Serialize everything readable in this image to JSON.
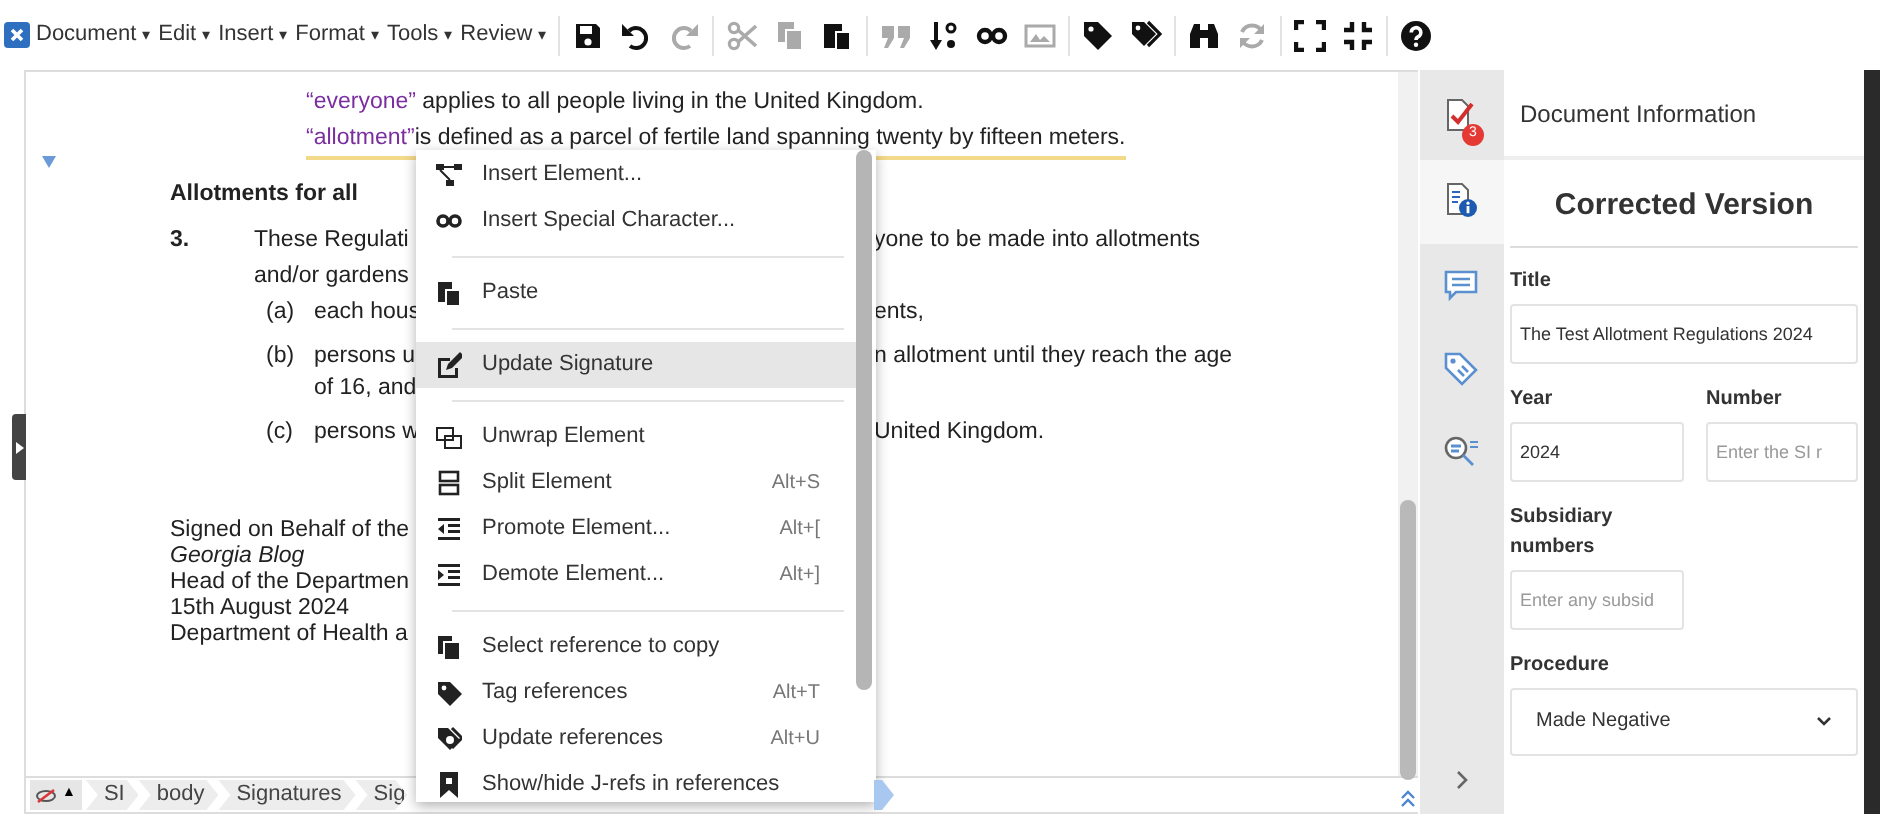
{
  "menubar": [
    {
      "label": "Document",
      "caret": "▾"
    },
    {
      "label": "Edit",
      "caret": "▾"
    },
    {
      "label": "Insert",
      "caret": "▾"
    },
    {
      "label": "Format",
      "caret": "▾"
    },
    {
      "label": "Tools",
      "caret": "▾"
    },
    {
      "label": "Review",
      "caret": "▾"
    }
  ],
  "toolbar": {
    "groups": [
      [
        {
          "disabled": false
        },
        {
          "disabled": false
        },
        {
          "disabled": true
        }
      ],
      [
        {
          "disabled": true
        },
        {
          "disabled": true
        },
        {
          "disabled": false
        }
      ],
      [
        {
          "disabled": true
        },
        {
          "disabled": false
        },
        {
          "disabled": false
        },
        {
          "disabled": true
        }
      ],
      [
        {
          "disabled": false
        },
        {
          "disabled": false
        }
      ],
      [
        {
          "disabled": false
        },
        {
          "disabled": true
        }
      ],
      [
        {
          "disabled": false
        },
        {
          "disabled": false
        }
      ],
      [
        {
          "disabled": false
        }
      ]
    ]
  },
  "document": {
    "definitions": [
      {
        "term": "“everyone”",
        "text": " applies to all people living in the United Kingdom.",
        "underlined": false
      },
      {
        "term": "“allotment”",
        "text": "is defined as a parcel of fertile land spanning twenty by fifteen meters.",
        "underlined": true
      }
    ],
    "heading": "Allotments for all",
    "paragraph": {
      "number": "3.",
      "lines": [
        {
          "left": "These Regulati",
          "right": "yone to be made into allotments"
        },
        {
          "left": "and/or gardens"
        }
      ]
    },
    "items": [
      {
        "label": "(a)",
        "lines": [
          {
            "left": "each hous",
            "right": "ents,"
          }
        ]
      },
      {
        "label": "(b)",
        "lines": [
          {
            "left": "persons u",
            "right": "n allotment until they reach the age"
          },
          {
            "left": "of 16, and"
          }
        ]
      },
      {
        "label": "(c)",
        "lines": [
          {
            "left": "persons w",
            "right": "United Kingdom."
          }
        ]
      }
    ],
    "signature": [
      {
        "text": "Signed on Behalf of the",
        "italic": false
      },
      {
        "text": "Georgia Blog",
        "italic": true
      },
      {
        "text": "Head of the Departmen",
        "italic": false
      },
      {
        "text": "15th August 2024",
        "italic": false
      },
      {
        "text": "Department of Health a",
        "italic": false
      }
    ]
  },
  "breadcrumb": {
    "toggle": "▲",
    "items": [
      {
        "label": "SI",
        "selected": false
      },
      {
        "label": "body",
        "selected": false
      },
      {
        "label": "Signatures",
        "selected": false
      },
      {
        "label": "Sig",
        "selected": false
      },
      {
        "selected": true
      }
    ]
  },
  "context_menu": [
    {
      "kind": "item",
      "label": "Insert Element...",
      "selected": false
    },
    {
      "kind": "item",
      "label": "Insert Special Character...",
      "selected": false
    },
    {
      "kind": "separator"
    },
    {
      "kind": "item",
      "label": "Paste",
      "selected": false
    },
    {
      "kind": "separator"
    },
    {
      "kind": "item",
      "label": "Update Signature",
      "selected": true
    },
    {
      "kind": "separator"
    },
    {
      "kind": "item",
      "label": "Unwrap Element",
      "selected": false
    },
    {
      "kind": "item",
      "label": "Split Element",
      "shortcut": "Alt+S",
      "selected": false
    },
    {
      "kind": "item",
      "label": "Promote Element...",
      "shortcut": "Alt+[",
      "selected": false
    },
    {
      "kind": "item",
      "label": "Demote Element...",
      "shortcut": "Alt+]",
      "selected": false
    },
    {
      "kind": "separator"
    },
    {
      "kind": "item",
      "label": "Select reference to copy",
      "selected": false
    },
    {
      "kind": "item",
      "label": "Tag references",
      "shortcut": "Alt+T",
      "selected": false
    },
    {
      "kind": "item",
      "label": "Update references",
      "shortcut": "Alt+U",
      "selected": false
    },
    {
      "kind": "item",
      "label": "Show/hide J-refs in references",
      "selected": false
    }
  ],
  "side_tabs": [
    {
      "selected": false,
      "badge": "3"
    },
    {
      "selected": true
    },
    {
      "selected": false
    },
    {
      "selected": false
    },
    {
      "selected": false
    }
  ],
  "panel": {
    "header": "Document Information",
    "title": "Corrected Version",
    "fields": [
      {
        "kind": "input",
        "label": "Title",
        "value": "The Test Allotment Regulations 2024"
      },
      {
        "kind": "input",
        "label": "Year",
        "value": "2024"
      },
      {
        "kind": "input",
        "label": "Number",
        "placeholder": "Enter the SI r"
      },
      {
        "kind": "input",
        "label": "Subsidiary numbers",
        "placeholder": "Enter any subsid"
      },
      {
        "kind": "select",
        "label": "Procedure",
        "value": "Made Negative"
      }
    ]
  }
}
